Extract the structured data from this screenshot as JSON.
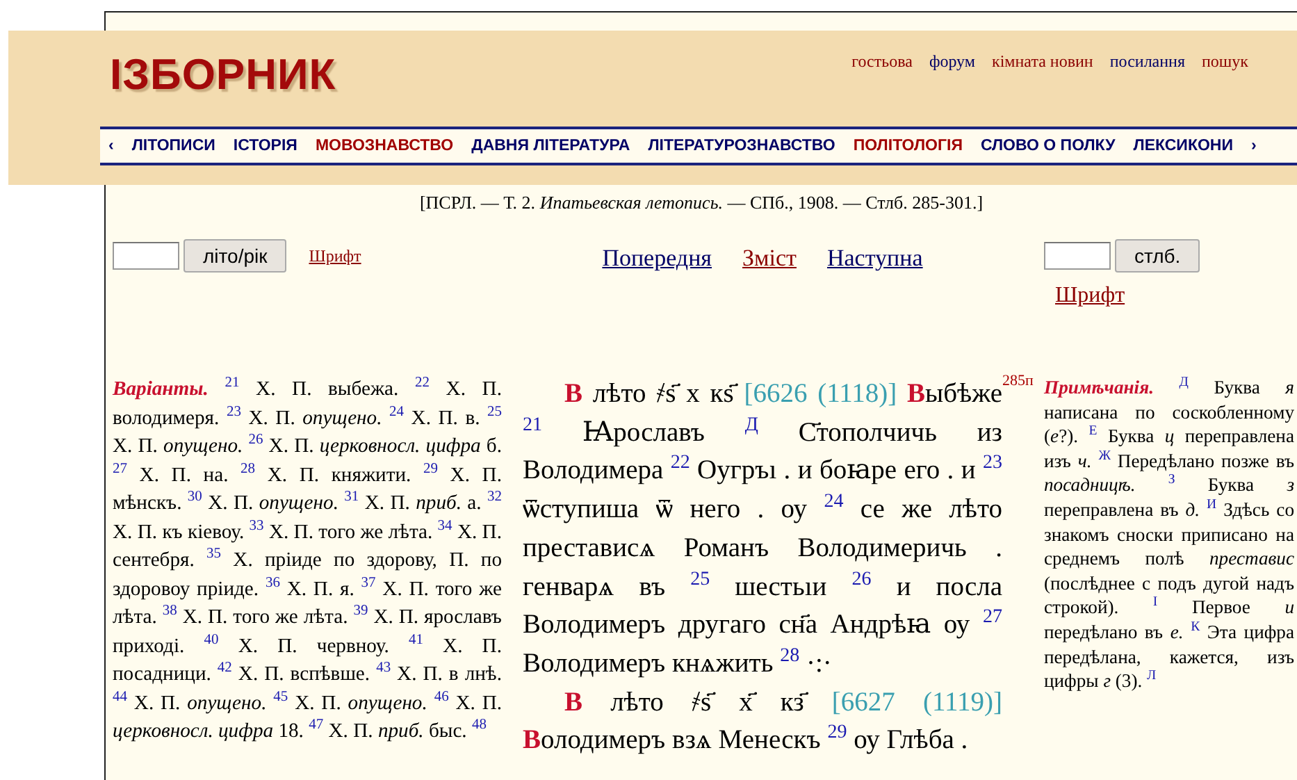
{
  "header": {
    "logo": "ІЗБОРНИК",
    "links": [
      {
        "label": "гостьова",
        "color": "#8b0000"
      },
      {
        "label": "форум",
        "color": "#000066"
      },
      {
        "label": "кімната новин",
        "color": "#8b0000"
      },
      {
        "label": "посилання",
        "color": "#000066"
      },
      {
        "label": "пошук",
        "color": "#8b0000"
      }
    ]
  },
  "nav": {
    "prev": "‹",
    "next": "›",
    "items": [
      {
        "label": "ЛІТОПИСИ",
        "color": "#000066"
      },
      {
        "label": "ІСТОРІЯ",
        "color": "#000066"
      },
      {
        "label": "МОВОЗНАВСТВО",
        "color": "#a00000"
      },
      {
        "label": "ДАВНЯ ЛІТЕРАТУРА",
        "color": "#000066"
      },
      {
        "label": "ЛІТЕРАТУРОЗНАВСТВО",
        "color": "#000066"
      },
      {
        "label": "ПОЛІТОЛОГІЯ",
        "color": "#a00000"
      },
      {
        "label": "СЛОВО О ПОЛКУ",
        "color": "#000066"
      },
      {
        "label": "ЛЕКСИКОНИ",
        "color": "#000066"
      }
    ]
  },
  "citation": "[ПСРЛ. — Т. 2. *Ипатьевская летопись.* — СПб., 1908. — Стлб. 285-301.]",
  "controls": {
    "year_button": "літо/рік",
    "font_link_left": "Шрифт",
    "pages": [
      {
        "label": "Попередня",
        "color": "#000066"
      },
      {
        "label": "Зміст",
        "color": "#8b0000"
      },
      {
        "label": "Наступна",
        "color": "#000066"
      }
    ],
    "column_button": "стлб.",
    "font_link_right": "Шрифт"
  },
  "variants": "**Варіанты.** $^{21}$ Х. П. выбежа. $^{22}$ Х. П. володимеря. $^{23}$ Х. П. *опущено.* $^{24}$ Х. П. в. $^{25}$ Х. П. *опущено.* $^{26}$ Х. П. *церковносл. цифра* б. $^{27}$ Х. П. на. $^{28}$ Х. П. княжити. $^{29}$ Х. П. мѣнскъ. $^{30}$ Х. П. *опущено.* $^{31}$ Х. П. *приб.* а. $^{32}$ Х. П. къ кіевоу. $^{33}$ Х. П. того же лѣта. $^{34}$ Х. П. сентебря. $^{35}$ Х. пріиде по здорову, П. по здоровоу пріиде. $^{36}$ Х. П. я. $^{37}$ Х. П. того же лѣта. $^{38}$ Х. П. того же лѣта. $^{39}$ Х. П. ярославъ приході. $^{40}$ Х. П. червноу. $^{41}$ Х. П. посадници. $^{42}$ Х. П. вспѣвше. $^{43}$ Х. П. в лнѣ. $^{44}$ Х. П. *опущено.* $^{45}$ Х. П. *опущено.* $^{46}$ Х. П. *церковносл. цифра* 18. $^{47}$ Х. П. *приб.* быс. $^{48}$",
  "chronicle": [
    {
      "initial": "В",
      "date": "лѣто ҂ѕ҃ х кѕ҃",
      "year": "[6626 (1118)]",
      "text": "**В**ыбѣже $^{21}$ Ꙗрославъ $^{Д}$ С҃тополчичь из Володимера $^{22}$ Оугръı . и боꙗре его . и $^{23}$ ѿступиша ѿ него . оу $^{24}$ се же лѣто престависѧ Романъ Володимеричь . генварѧ въ $^{25}$ шестьıи $^{26}$ и посла Володимеръ другаго сн҃а Андрѣꙗ оу $^{27}$ Володимеръ кнѧжить $^{28}$ ·:·"
    },
    {
      "initial": "В",
      "date": "лѣто ҂ѕ҃ х҃ кз҃",
      "year": "[6627 (1119)]",
      "text": "**В**олодимеръ взѧ Менескъ $^{29}$ оу Глѣба ."
    }
  ],
  "page_marker": "285п",
  "notes": "**Примѣчанія.** $^{Д}$ Буква *я* написана по соскобленному (*е*?). $^{Е}$ Буква *ц* переправлена изъ *ч.* $^{Ж}$ Передѣлано позже въ *посадницѣ.* $^{З}$ Буква *з* переправлена въ *д.* $^{И}$ Здѣсь со знакомъ сноски приписано на среднемъ полѣ *преставис* (послѣднее с подъ дугой надъ строкой). $^{І}$ Первое *и* передѣлано въ *е.* $^{К}$ Эта цифра передѣлана, кажется, изъ цифры *г* (3). $^{Л}$"
}
